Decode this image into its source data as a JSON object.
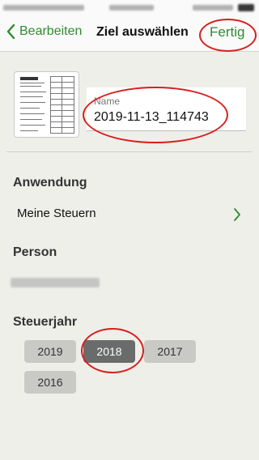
{
  "nav": {
    "back_label": "Bearbeiten",
    "title": "Ziel auswählen",
    "done_label": "Fertig"
  },
  "document": {
    "name_label": "Name",
    "name_value": "2019-11-13_114743"
  },
  "sections": {
    "application_heading": "Anwendung",
    "application_value": "Meine Steuern",
    "person_heading": "Person",
    "tax_year_heading": "Steuerjahr"
  },
  "tax_years": [
    "2019",
    "2018",
    "2017",
    "2016"
  ],
  "selected_year": "2018",
  "icons": {
    "back": "chevron-left-icon",
    "row": "chevron-right-icon"
  },
  "colors": {
    "accent": "#2e8b2e",
    "selected_chip": "#6a6c6b",
    "chip": "#c9c9c6",
    "annotation": "#d81e1e",
    "background": "#efefea"
  }
}
